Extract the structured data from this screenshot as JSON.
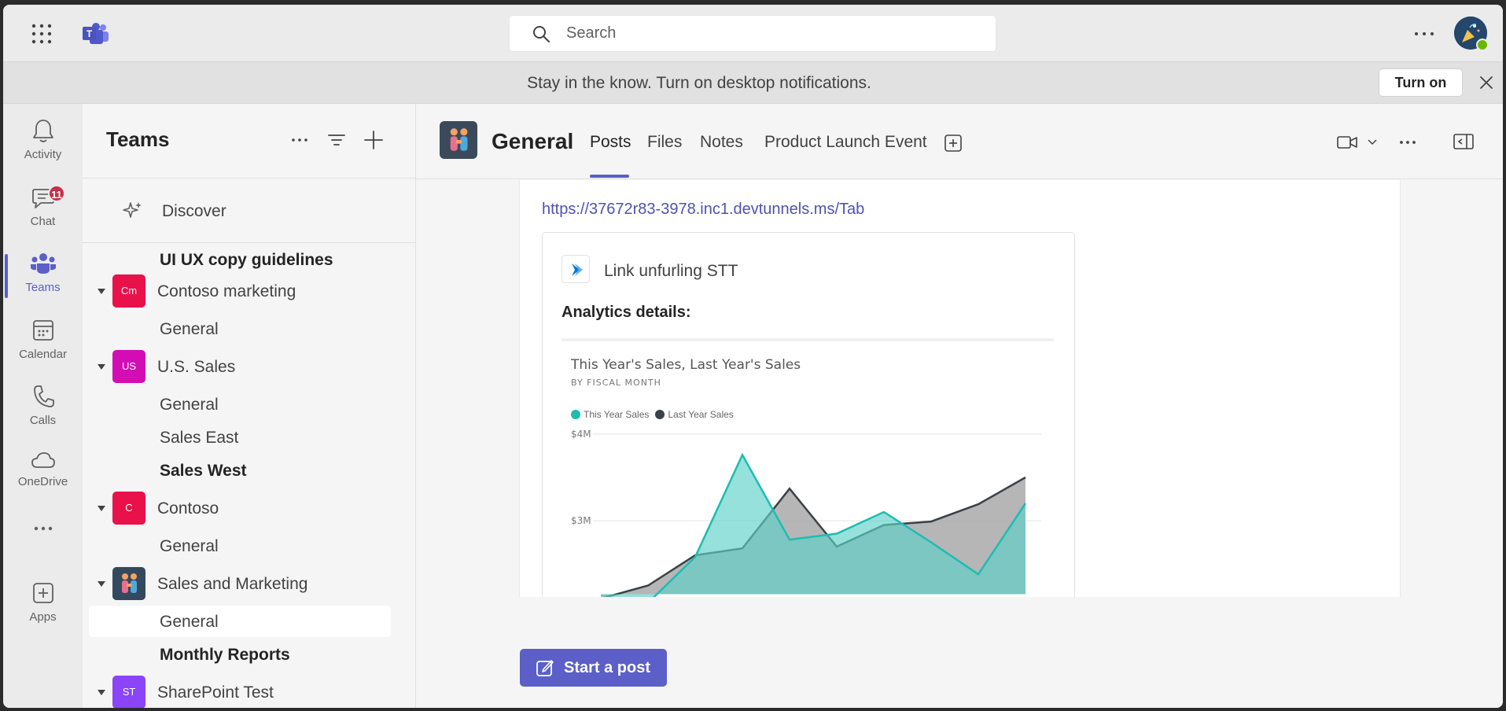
{
  "search": {
    "placeholder": "Search"
  },
  "banner": {
    "message": "Stay in the know. Turn on desktop notifications.",
    "turn_on_label": "Turn on"
  },
  "rail": {
    "items": [
      {
        "label": "Activity",
        "icon": "bell-icon"
      },
      {
        "label": "Chat",
        "icon": "chat-icon",
        "badge": "11"
      },
      {
        "label": "Teams",
        "icon": "teams-icon",
        "active": true
      },
      {
        "label": "Calendar",
        "icon": "calendar-icon"
      },
      {
        "label": "Calls",
        "icon": "phone-icon"
      },
      {
        "label": "OneDrive",
        "icon": "cloud-icon"
      },
      {
        "label": "Apps",
        "icon": "add-app-icon"
      }
    ]
  },
  "teams_panel": {
    "title": "Teams",
    "discover_label": "Discover",
    "tree": [
      {
        "kind": "channel",
        "label": "UI UX copy guidelines",
        "bold": true
      },
      {
        "kind": "team",
        "label": "Contoso marketing",
        "initials": "Cm",
        "color": "#e8114a"
      },
      {
        "kind": "channel",
        "label": "General"
      },
      {
        "kind": "team",
        "label": "U.S. Sales",
        "initials": "US",
        "color": "#d20db4"
      },
      {
        "kind": "channel",
        "label": "General"
      },
      {
        "kind": "channel",
        "label": "Sales East"
      },
      {
        "kind": "channel",
        "label": "Sales West",
        "bold": true
      },
      {
        "kind": "team",
        "label": "Contoso",
        "initials": "C",
        "color": "#e8114a"
      },
      {
        "kind": "channel",
        "label": "General"
      },
      {
        "kind": "team",
        "label": "Sales and Marketing",
        "initials": "",
        "color": "#34495e"
      },
      {
        "kind": "channel",
        "label": "General",
        "selected": true
      },
      {
        "kind": "channel",
        "label": "Monthly Reports",
        "bold": true
      },
      {
        "kind": "team",
        "label": "SharePoint Test",
        "initials": "ST",
        "color": "#8b44f7"
      }
    ]
  },
  "channel": {
    "title": "General",
    "tabs": [
      "Posts",
      "Files",
      "Notes",
      "Product Launch Event"
    ],
    "active_tab": "Posts"
  },
  "post": {
    "link": "https://37672r83-3978.inc1.devtunnels.ms/Tab",
    "card": {
      "app_name": "Link unfurling STT",
      "subtitle": "Analytics details:"
    }
  },
  "chart_data": {
    "type": "area",
    "title": "This Year's Sales, Last Year's Sales",
    "subtitle": "BY FISCAL MONTH",
    "ylabel": "",
    "y_tick_labels": [
      "$4M",
      "$3M"
    ],
    "y_ticks": [
      4,
      3
    ],
    "ylim": [
      2.15,
      4.0
    ],
    "x": [
      1,
      2,
      3,
      4,
      5,
      6,
      7,
      8,
      9,
      10
    ],
    "series": [
      {
        "name": "This Year Sales",
        "color": "#1ebcb2",
        "values": [
          2.0,
          2.05,
          2.58,
          3.76,
          2.78,
          2.85,
          3.1,
          2.75,
          2.38,
          3.2
        ]
      },
      {
        "name": "Last Year Sales",
        "color": "#3a4247",
        "values": [
          2.1,
          2.25,
          2.6,
          2.68,
          3.37,
          2.7,
          2.95,
          2.99,
          3.19,
          3.5
        ]
      }
    ]
  },
  "composer": {
    "start_post_label": "Start a post"
  }
}
